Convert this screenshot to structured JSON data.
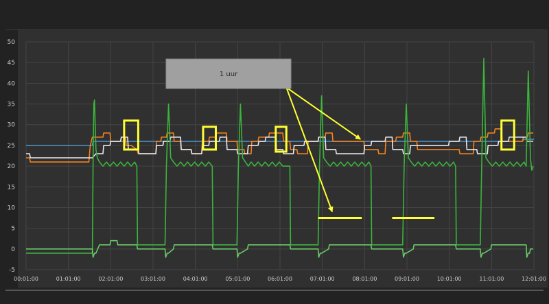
{
  "chart_data": {
    "type": "line",
    "title": "",
    "xlabel": "",
    "ylabel": "",
    "ylim": [
      -5,
      50
    ],
    "yticks": [
      -5,
      0,
      5,
      10,
      15,
      20,
      25,
      30,
      35,
      40,
      45,
      50
    ],
    "xlim": [
      "00:01:00",
      "12:01:00"
    ],
    "xticks": [
      "00:01:00",
      "01:01:00",
      "02:01:00",
      "03:01:00",
      "04:01:00",
      "05:01:00",
      "06:01:00",
      "07:01:00",
      "08:01:00",
      "09:01:00",
      "10:01:00",
      "11:01:00",
      "12:01:00"
    ],
    "grid": true,
    "legend": "none",
    "background": "#303030",
    "series": [
      {
        "color": "#4a90c8",
        "x": [
          "00:01",
          "01:35",
          "01:36",
          "11:45",
          "11:46",
          "12:01"
        ],
        "y": [
          25,
          25,
          26,
          26,
          26.5,
          26.5
        ]
      },
      {
        "color": "#f58220",
        "x": [
          "00:01",
          "00:06",
          "00:07",
          "01:30",
          "01:32",
          "01:35",
          "01:38",
          "01:50",
          "01:51",
          "02:00",
          "02:01",
          "02:15",
          "02:16",
          "02:22",
          "02:23",
          "02:30",
          "02:38",
          "02:40",
          "02:50",
          "03:05",
          "03:06",
          "03:12",
          "03:13",
          "03:20",
          "03:21",
          "03:30",
          "03:31",
          "03:40",
          "03:41",
          "03:55",
          "03:56",
          "04:10",
          "04:11",
          "04:20",
          "04:21",
          "04:30",
          "04:31",
          "04:45",
          "04:46",
          "05:00",
          "05:01",
          "05:10",
          "05:11",
          "05:20",
          "05:21",
          "05:30",
          "05:31",
          "05:45",
          "05:46",
          "06:05",
          "06:06",
          "06:15",
          "06:16",
          "06:25",
          "06:26",
          "06:40",
          "06:41",
          "06:55",
          "06:56",
          "07:05",
          "07:06",
          "07:15",
          "07:16",
          "08:00",
          "08:01",
          "08:20",
          "08:21",
          "08:30",
          "08:31",
          "08:45",
          "08:46",
          "08:55",
          "08:56",
          "09:05",
          "09:06",
          "09:15",
          "09:16",
          "10:15",
          "10:16",
          "10:35",
          "10:36",
          "10:45",
          "10:46",
          "10:55",
          "10:56",
          "11:05",
          "11:06",
          "11:15",
          "11:16",
          "11:45",
          "11:46",
          "11:52",
          "11:53",
          "12:00"
        ],
        "y": [
          22,
          22,
          21,
          21,
          25,
          27,
          27,
          27,
          28,
          28,
          26,
          26,
          27,
          27,
          25,
          25,
          24,
          23,
          23,
          23,
          26,
          26,
          27,
          27,
          28,
          28,
          26,
          26,
          24,
          24,
          23,
          23,
          26,
          26,
          27,
          27,
          28,
          28,
          26,
          26,
          24,
          24,
          23,
          23,
          26,
          26,
          27,
          27,
          28,
          28,
          26,
          26,
          24,
          24,
          23,
          23,
          26,
          26,
          27,
          27,
          28,
          28,
          26,
          26,
          24,
          24,
          23,
          23,
          26,
          26,
          27,
          27,
          28,
          28,
          26,
          26,
          24,
          24,
          23,
          23,
          26,
          26,
          27,
          27,
          28,
          28,
          29,
          29,
          26,
          26,
          27,
          27,
          28,
          28
        ]
      },
      {
        "color": "#e8e8f0",
        "x": [
          "00:01",
          "00:06",
          "00:07",
          "01:35",
          "01:40",
          "01:50",
          "01:51",
          "02:00",
          "02:01",
          "02:15",
          "02:16",
          "02:25",
          "02:26",
          "02:40",
          "02:41",
          "03:05",
          "03:06",
          "03:15",
          "03:16",
          "03:25",
          "03:26",
          "03:40",
          "03:41",
          "03:55",
          "03:56",
          "04:10",
          "04:11",
          "04:20",
          "04:21",
          "04:35",
          "04:36",
          "04:45",
          "04:46",
          "05:00",
          "05:01",
          "05:15",
          "05:16",
          "05:30",
          "05:31",
          "05:40",
          "05:41",
          "05:55",
          "05:56",
          "06:05",
          "06:06",
          "06:20",
          "06:21",
          "06:35",
          "06:36",
          "06:55",
          "06:56",
          "07:05",
          "07:06",
          "07:20",
          "07:21",
          "08:00",
          "08:01",
          "08:10",
          "08:11",
          "08:30",
          "08:31",
          "08:40",
          "08:41",
          "08:55",
          "08:56",
          "09:05",
          "09:06",
          "10:00",
          "10:01",
          "10:15",
          "10:16",
          "10:25",
          "10:26",
          "10:40",
          "10:41",
          "10:55",
          "10:56",
          "11:10",
          "11:11",
          "11:25",
          "11:26",
          "11:50",
          "11:51",
          "12:00"
        ],
        "y": [
          23,
          23,
          22,
          22,
          23,
          23,
          25,
          25,
          26,
          26,
          27,
          27,
          24,
          24,
          23,
          23,
          25,
          25,
          26,
          26,
          27,
          27,
          24,
          24,
          23,
          23,
          25,
          25,
          26,
          26,
          27,
          27,
          24,
          24,
          23,
          23,
          25,
          25,
          26,
          26,
          27,
          27,
          24,
          24,
          23,
          23,
          25,
          25,
          26,
          26,
          27,
          27,
          24,
          24,
          23,
          23,
          25,
          25,
          26,
          26,
          27,
          27,
          24,
          24,
          23,
          23,
          25,
          25,
          26,
          26,
          27,
          27,
          24,
          24,
          23,
          23,
          25,
          25,
          26,
          26,
          27,
          27,
          26,
          26
        ]
      },
      {
        "color": "#3cb43c",
        "x": [
          "00:01",
          "01:35",
          "01:36",
          "01:37",
          "01:38",
          "01:40",
          "01:42",
          "01:45",
          "01:50",
          "01:55",
          "02:00",
          "02:05",
          "02:10",
          "02:15",
          "02:20",
          "02:25",
          "02:30",
          "02:35",
          "02:38",
          "02:39",
          "03:18",
          "03:20",
          "03:23",
          "03:26",
          "03:30",
          "03:35",
          "03:40",
          "03:45",
          "03:50",
          "03:55",
          "04:00",
          "04:05",
          "04:10",
          "04:15",
          "04:20",
          "04:25",
          "04:26",
          "05:00",
          "05:02",
          "05:05",
          "05:08",
          "05:12",
          "05:16",
          "05:20",
          "05:25",
          "05:30",
          "05:35",
          "05:40",
          "05:45",
          "05:50",
          "05:55",
          "06:00",
          "06:05",
          "06:15",
          "06:16",
          "06:55",
          "06:57",
          "07:00",
          "07:03",
          "07:07",
          "07:12",
          "07:17",
          "07:22",
          "07:27",
          "07:32",
          "07:37",
          "07:42",
          "07:47",
          "07:52",
          "07:57",
          "08:02",
          "08:07",
          "08:10",
          "08:11",
          "08:55",
          "08:57",
          "09:00",
          "09:03",
          "09:07",
          "09:12",
          "09:17",
          "09:22",
          "09:27",
          "09:32",
          "09:37",
          "09:42",
          "09:47",
          "09:52",
          "09:57",
          "10:02",
          "10:07",
          "10:10",
          "10:11",
          "10:45",
          "10:47",
          "10:50",
          "10:53",
          "10:57",
          "11:02",
          "11:07",
          "11:12",
          "11:17",
          "11:22",
          "11:27",
          "11:32",
          "11:37",
          "11:42",
          "11:47",
          "11:50",
          "11:53",
          "11:56",
          "11:58",
          "12:00"
        ],
        "y": [
          -1,
          -1,
          20,
          35,
          36,
          24,
          22,
          21,
          20,
          21,
          20,
          21,
          20,
          21,
          20,
          21,
          20,
          21,
          20,
          1,
          1,
          20,
          35,
          22,
          21,
          20,
          21,
          20,
          21,
          20,
          21,
          20,
          21,
          20,
          21,
          20,
          1,
          1,
          20,
          35,
          22,
          21,
          20,
          21,
          20,
          21,
          20,
          21,
          20,
          21,
          20,
          21,
          20,
          20,
          1,
          1,
          20,
          37,
          22,
          21,
          20,
          21,
          20,
          21,
          20,
          21,
          20,
          21,
          20,
          21,
          20,
          21,
          20,
          1,
          1,
          20,
          35,
          22,
          21,
          20,
          21,
          20,
          21,
          20,
          21,
          20,
          21,
          20,
          21,
          20,
          21,
          20,
          1,
          1,
          20,
          46,
          22,
          21,
          20,
          21,
          20,
          21,
          20,
          21,
          20,
          21,
          20,
          21,
          20,
          43,
          22,
          19,
          20
        ]
      },
      {
        "color": "#6ac86a",
        "x": [
          "00:01",
          "01:35",
          "01:36",
          "01:38",
          "01:40",
          "01:45",
          "01:46",
          "02:00",
          "02:01",
          "02:10",
          "02:11",
          "02:38",
          "02:39",
          "03:18",
          "03:19",
          "03:21",
          "03:23",
          "03:30",
          "03:31",
          "03:45",
          "03:46",
          "04:00",
          "04:01",
          "04:25",
          "04:26",
          "05:00",
          "05:01",
          "05:03",
          "05:05",
          "05:15",
          "05:16",
          "05:30",
          "05:31",
          "05:50",
          "05:51",
          "06:15",
          "06:16",
          "06:55",
          "06:56",
          "06:58",
          "07:00",
          "07:10",
          "07:11",
          "07:25",
          "07:26",
          "08:10",
          "08:11",
          "08:55",
          "08:56",
          "08:58",
          "09:00",
          "09:10",
          "09:11",
          "09:25",
          "09:26",
          "10:10",
          "10:11",
          "10:45",
          "10:46",
          "10:48",
          "10:50",
          "11:00",
          "11:01",
          "11:15",
          "11:16",
          "11:35",
          "11:36",
          "11:50",
          "11:51",
          "11:53",
          "11:55",
          "11:56",
          "12:00"
        ],
        "y": [
          0,
          0,
          -2,
          -1,
          -1,
          1,
          1,
          1,
          2,
          2,
          1,
          1,
          0,
          0,
          -2,
          -1,
          -1,
          0,
          1,
          1,
          1,
          1,
          1,
          1,
          0,
          0,
          -2,
          -1,
          -1,
          0,
          1,
          1,
          1,
          1,
          1,
          1,
          0,
          0,
          -2,
          -1,
          -1,
          0,
          1,
          1,
          1,
          1,
          0,
          0,
          -2,
          -1,
          -1,
          0,
          1,
          1,
          1,
          1,
          0,
          0,
          -2,
          -1,
          -1,
          0,
          1,
          1,
          1,
          1,
          1,
          1,
          -2,
          -1,
          -1,
          0,
          0
        ]
      }
    ],
    "annotations": {
      "label": "1 uur",
      "label_box_color": "#a0a0a0",
      "highlight_color": "#ffff33",
      "boxes": [
        {
          "x": [
            "02:20",
            "02:40"
          ],
          "y": [
            24,
            31
          ]
        },
        {
          "x": [
            "04:12",
            "04:30"
          ],
          "y": [
            24,
            29.5
          ]
        },
        {
          "x": [
            "05:55",
            "06:10"
          ],
          "y": [
            23.5,
            29.5
          ]
        },
        {
          "x": [
            "11:15",
            "11:33"
          ],
          "y": [
            24,
            31
          ]
        }
      ],
      "segments": [
        {
          "x": [
            "06:55",
            "07:57"
          ],
          "y": [
            7.5,
            7.5
          ]
        },
        {
          "x": [
            "08:40",
            "09:40"
          ],
          "y": [
            7.5,
            7.5
          ]
        }
      ],
      "arrows": [
        {
          "from": [
            "06:10",
            39
          ],
          "to": [
            "07:55",
            26.5
          ]
        },
        {
          "from": [
            "06:10",
            39
          ],
          "to": [
            "07:15",
            9
          ]
        }
      ]
    }
  }
}
